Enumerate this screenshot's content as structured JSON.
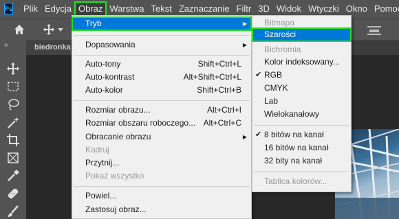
{
  "menubar": {
    "logo": "Ps",
    "items": [
      "Plik",
      "Edycja",
      "Obraz",
      "Warstwa",
      "Tekst",
      "Zaznaczanie",
      "Filtr",
      "3D",
      "Widok",
      "Wtyczki",
      "Okno",
      "Pomoc"
    ],
    "active": "Obraz"
  },
  "document": {
    "tab_label": "biedronka"
  },
  "toolbar": {
    "collapse": "»"
  },
  "image_menu": {
    "tryb": "Tryb",
    "dopasowania": "Dopasowania",
    "auto_tony": "Auto-tony",
    "auto_tony_sc": "Shift+Ctrl+L",
    "auto_kontrast": "Auto-kontrast",
    "auto_kontrast_sc": "Alt+Shift+Ctrl+L",
    "auto_kolor": "Auto-kolor",
    "auto_kolor_sc": "Shift+Ctrl+B",
    "rozmiar_obrazu": "Rozmiar obrazu...",
    "rozmiar_obrazu_sc": "Alt+Ctrl+I",
    "rozmiar_obszaru": "Rozmiar obszaru roboczego...",
    "rozmiar_obszaru_sc": "Alt+Ctrl+C",
    "obracanie": "Obracanie obrazu",
    "kadruj": "Kadruj",
    "przytnij": "Przytnij...",
    "pokaz_wszystko": "Pokaż wszystko",
    "powiel": "Powiel...",
    "zastosuj": "Zastosuj obraz..."
  },
  "mode_submenu": {
    "bitmapa": "Bitmapa",
    "szarosci": "Szarości",
    "bichromia": "Bichromia",
    "kolor_indeksowany": "Kolor indeksowany...",
    "rgb": "RGB",
    "cmyk": "CMYK",
    "lab": "Lab",
    "wielokanalowy": "Wielokanałowy",
    "bit8": "8 bitów na kanał",
    "bit16": "16 bitów na kanał",
    "bit32": "32 bity na kanał",
    "tablica": "Tablica kolorów...",
    "checked_mode": "RGB",
    "checked_depth": "8 bitów na kanał"
  },
  "colors": {
    "highlight": "#0078d7",
    "annotation": "#22e01f",
    "menubar": "#535353"
  }
}
